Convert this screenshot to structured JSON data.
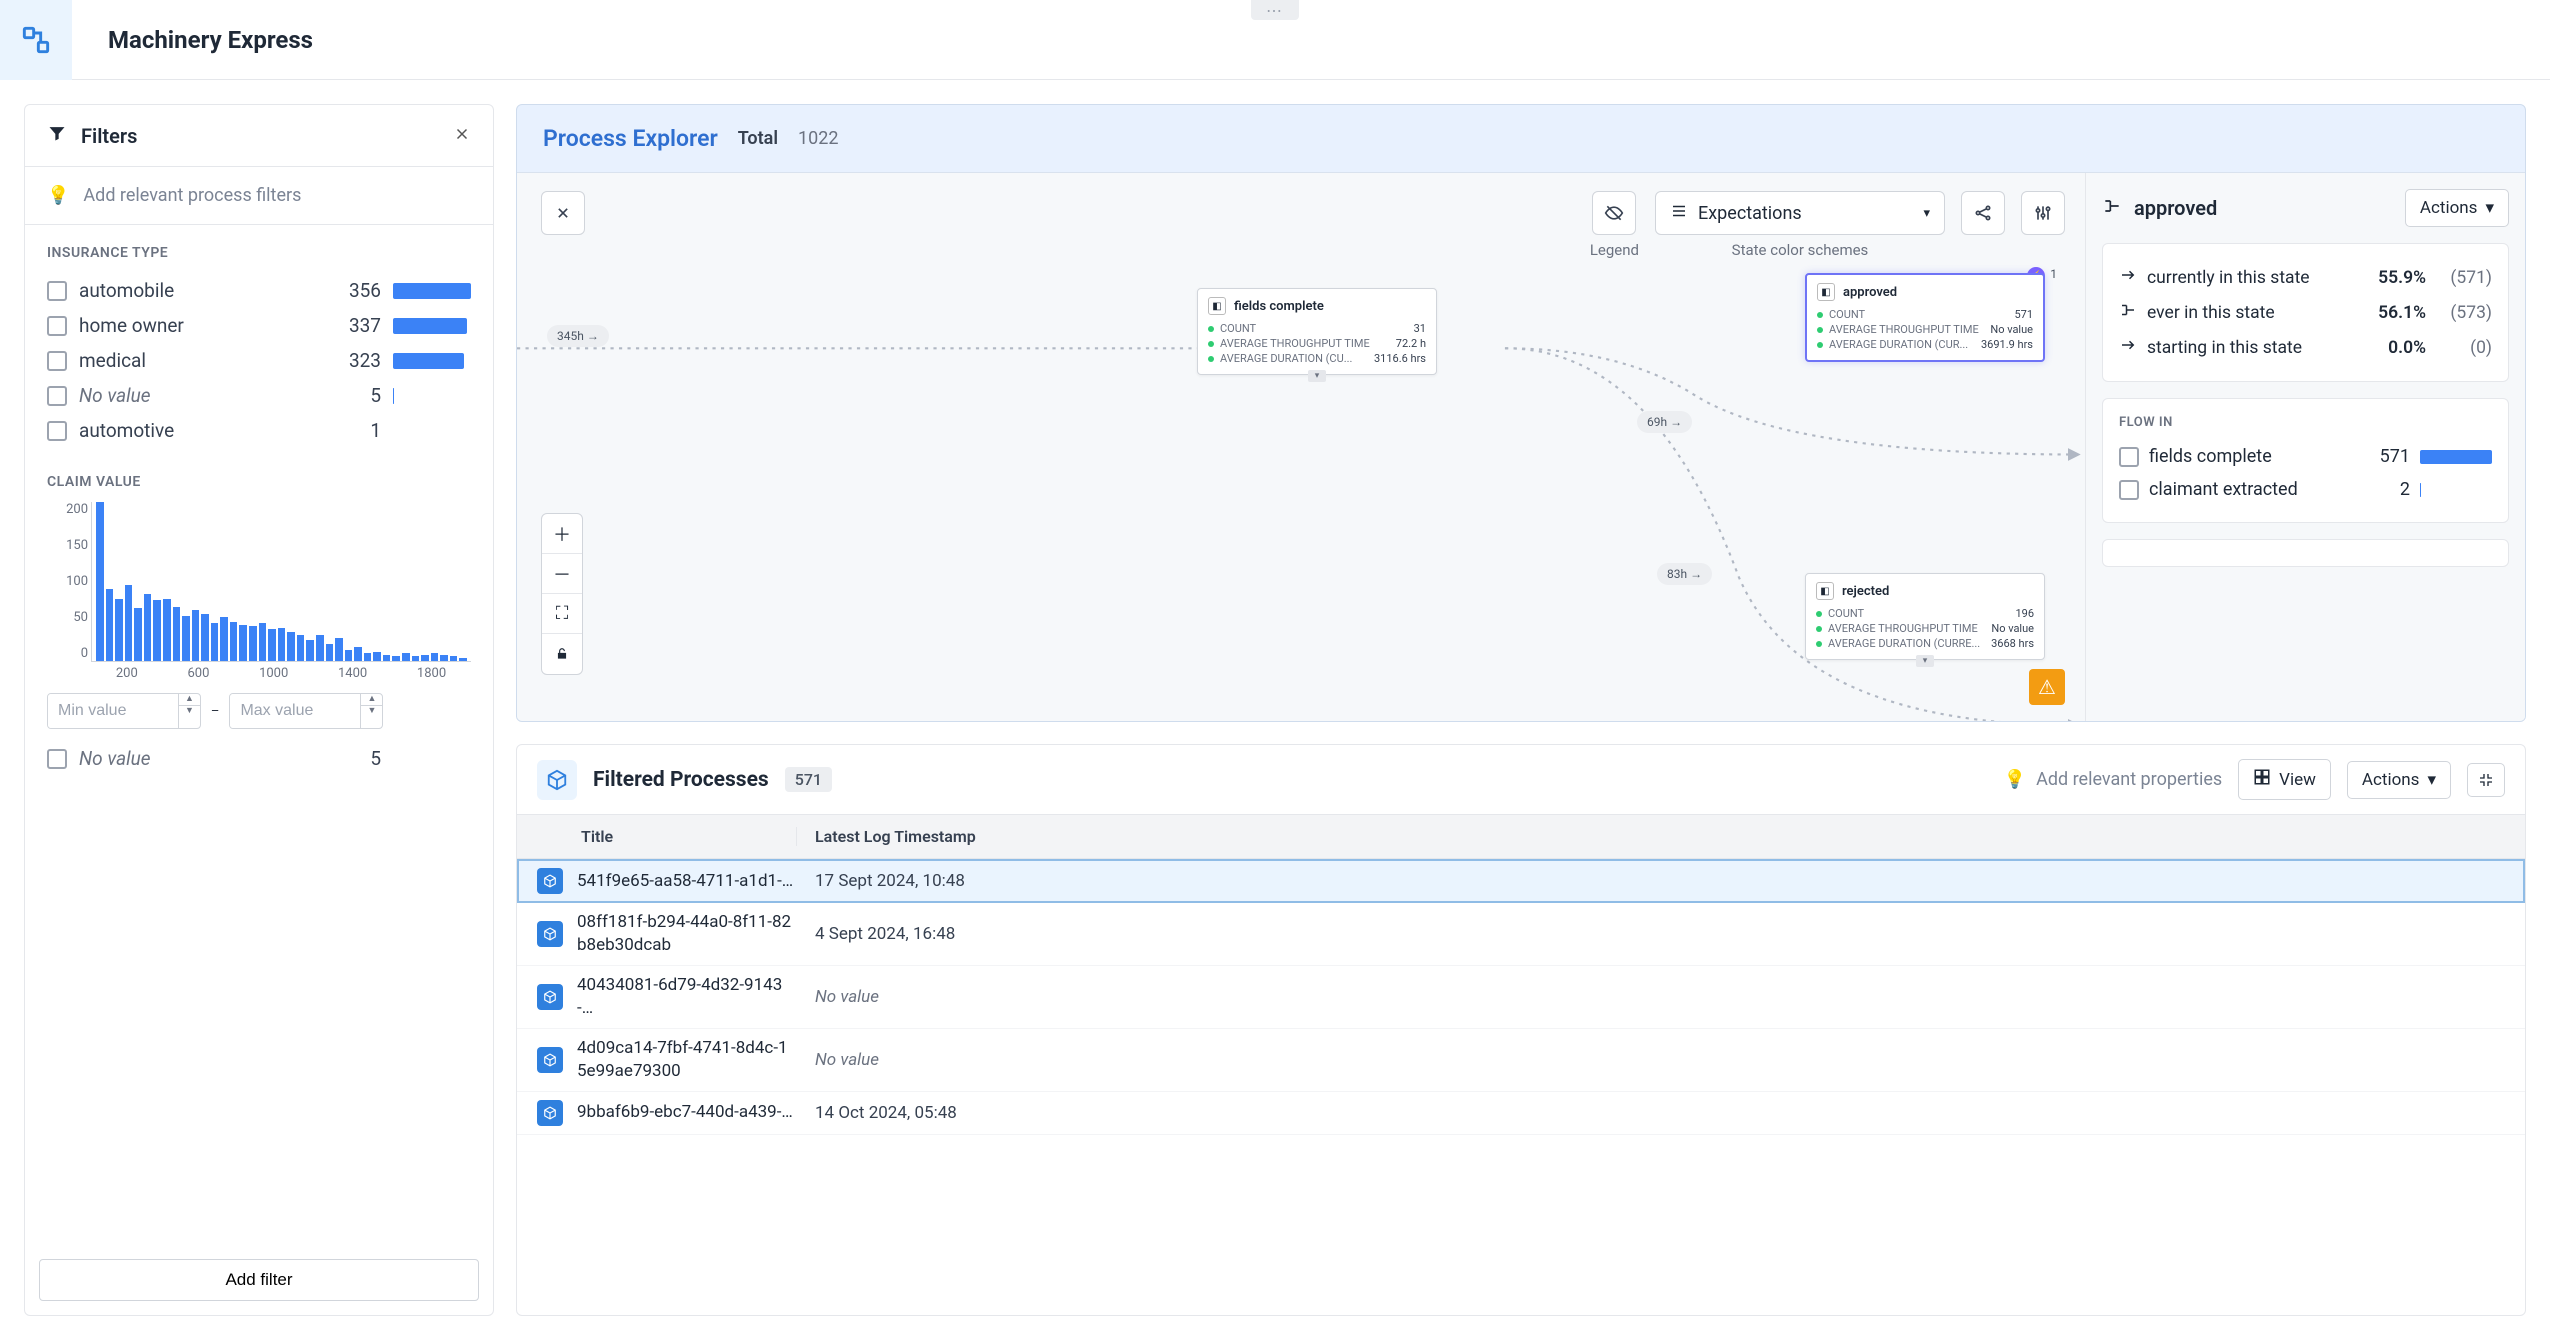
{
  "app_title": "Machinery Express",
  "filters": {
    "title": "Filters",
    "hint": "Add relevant process filters",
    "add_filter_label": "Add filter",
    "insurance_type": {
      "title": "INSURANCE TYPE",
      "items": [
        {
          "label": "automobile",
          "count": 356,
          "bar": 100
        },
        {
          "label": "home owner",
          "count": 337,
          "bar": 95
        },
        {
          "label": "medical",
          "count": 323,
          "bar": 91
        },
        {
          "label": "No value",
          "count": 5,
          "bar": 1,
          "italic": true
        },
        {
          "label": "automotive",
          "count": 1,
          "bar": 0
        }
      ]
    },
    "claim_value": {
      "title": "CLAIM VALUE",
      "yticks": [
        "200",
        "150",
        "100",
        "50",
        "0"
      ],
      "xticks": [
        "200",
        "600",
        "1000",
        "1400",
        "1800"
      ],
      "min_placeholder": "Min value",
      "max_placeholder": "Max value",
      "novalue_label": "No value",
      "novalue_count": 5
    }
  },
  "explorer": {
    "title": "Process Explorer",
    "total_label": "Total",
    "total_value": "1022",
    "legend_label": "Legend",
    "color_scheme_label": "State color schemes",
    "dropdown_value": "Expectations",
    "edges": {
      "e1": "345h →",
      "e2": "69h →",
      "e3": "83h →"
    },
    "nodes": {
      "fields": {
        "title": "fields complete",
        "stats": [
          {
            "label": "COUNT",
            "value": "31"
          },
          {
            "label": "AVERAGE THROUGHPUT TIME",
            "value": "72.2 h"
          },
          {
            "label": "AVERAGE DURATION (CU...",
            "value": "3116.6 hrs"
          }
        ]
      },
      "approved": {
        "title": "approved",
        "violations": "1",
        "stats": [
          {
            "label": "COUNT",
            "value": "571"
          },
          {
            "label": "AVERAGE THROUGHPUT TIME",
            "value": "No value"
          },
          {
            "label": "AVERAGE DURATION (CUR...",
            "value": "3691.9 hrs"
          }
        ]
      },
      "rejected": {
        "title": "rejected",
        "stats": [
          {
            "label": "COUNT",
            "value": "196"
          },
          {
            "label": "AVERAGE THROUGHPUT TIME",
            "value": "No value"
          },
          {
            "label": "AVERAGE DURATION (CURRE...",
            "value": "3668 hrs"
          }
        ]
      }
    }
  },
  "details": {
    "state_name": "approved",
    "actions_label": "Actions",
    "stats": [
      {
        "label": "currently in this state",
        "pct": "55.9%",
        "num": "(571)"
      },
      {
        "label": "ever in this state",
        "pct": "56.1%",
        "num": "(573)"
      },
      {
        "label": "starting in this state",
        "pct": "0.0%",
        "num": "(0)"
      }
    ],
    "flowin_title": "FLOW IN",
    "flowin": [
      {
        "label": "fields complete",
        "value": "571",
        "bar": 100
      },
      {
        "label": "claimant extracted",
        "value": "2",
        "bar": 2
      }
    ]
  },
  "table": {
    "title": "Filtered Processes",
    "count": "571",
    "hint": "Add relevant properties",
    "view_label": "View",
    "actions_label": "Actions",
    "columns": {
      "title": "Title",
      "ts": "Latest Log Timestamp"
    },
    "rows": [
      {
        "title": "541f9e65-aa58-4711-a1d1-…",
        "ts": "17 Sept 2024, 10:48",
        "selected": true
      },
      {
        "title": "08ff181f-b294-44a0-8f11-82b8eb30dcab",
        "ts": "4 Sept 2024, 16:48"
      },
      {
        "title": "40434081-6d79-4d32-9143-…",
        "ts": "No value",
        "novalue": true
      },
      {
        "title": "4d09ca14-7fbf-4741-8d4c-15e99ae79300",
        "ts": "No value",
        "novalue": true
      },
      {
        "title": "9bbaf6b9-ebc7-440d-a439-…",
        "ts": "14 Oct 2024, 05:48"
      }
    ]
  },
  "chart_data": {
    "type": "bar",
    "title": "CLAIM VALUE",
    "xlabel": "",
    "ylabel": "",
    "ylim": [
      0,
      220
    ],
    "xticks": [
      200,
      600,
      1000,
      1400,
      1800
    ],
    "values": [
      210,
      95,
      82,
      100,
      70,
      88,
      80,
      82,
      72,
      60,
      68,
      62,
      50,
      58,
      52,
      48,
      46,
      50,
      42,
      44,
      38,
      34,
      28,
      34,
      22,
      30,
      14,
      18,
      10,
      12,
      8,
      6,
      10,
      6,
      8,
      10,
      8,
      6,
      4
    ]
  }
}
